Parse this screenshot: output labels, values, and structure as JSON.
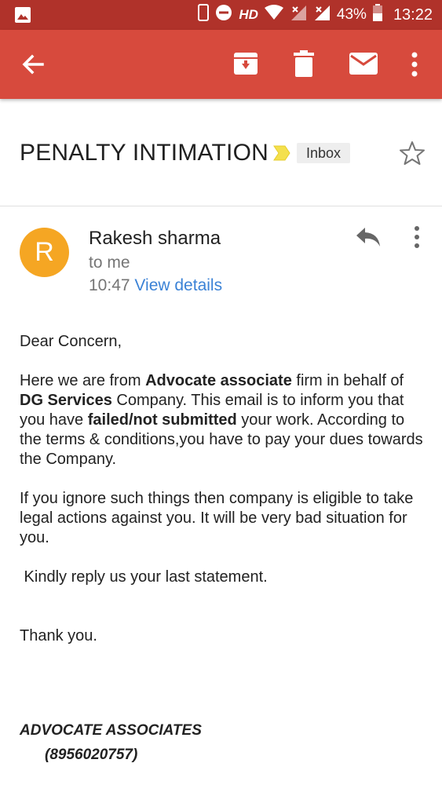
{
  "status_bar": {
    "network": "HD",
    "battery": "43%",
    "time": "13:22"
  },
  "toolbar": {
    "icons": [
      "back-arrow-icon",
      "archive-icon",
      "delete-icon",
      "mail-icon",
      "more-vert-icon"
    ]
  },
  "email": {
    "subject": "PENALTY INTIMATION",
    "label": "Inbox",
    "sender": {
      "initial": "R",
      "name": "Rakesh sharma",
      "recipient": "to me",
      "time": "10:47",
      "view_details": "View details"
    },
    "body": {
      "greeting": "Dear Concern,",
      "p1_a": "Here we are from ",
      "p1_b": "Advocate associate",
      "p1_c": " firm in behalf of ",
      "p1_d": "DG Services",
      "p1_e": " Company. This email is to inform you that you have ",
      "p1_f": "failed/not submitted",
      "p1_g": " your work. According to the terms & conditions,you have to pay your dues towards the Company.",
      "p2": "If you ignore such things then company is eligible to take legal actions against you. It will be very bad situation for you.",
      "p3": " Kindly reply us your last statement.",
      "p4": "Thank you."
    },
    "signature": {
      "name": "ADVOCATE ASSOCIATES",
      "phone": "(8956020757)"
    }
  },
  "colors": {
    "status_bar": "#b0322a",
    "toolbar": "#d74a3d",
    "avatar": "#f5a623",
    "link": "#3b82d6",
    "importance": "#f4e04d"
  }
}
